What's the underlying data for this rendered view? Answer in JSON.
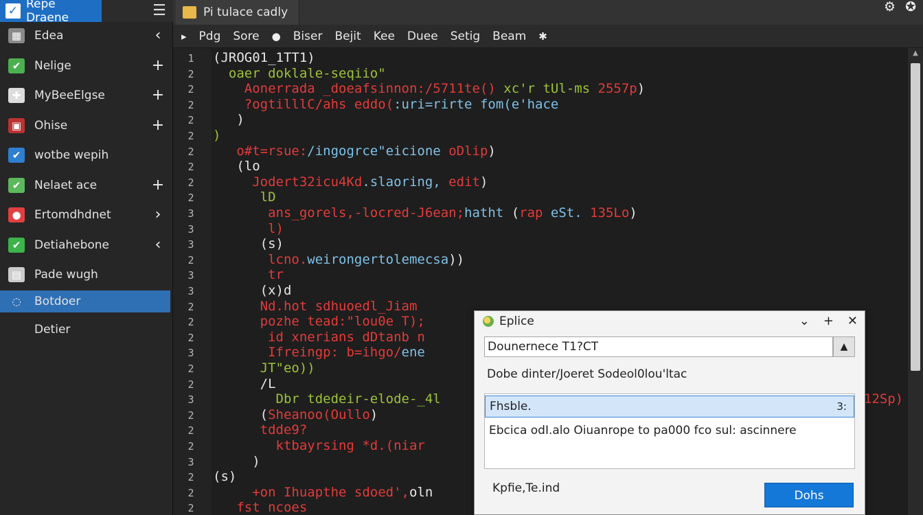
{
  "sidebar": {
    "title": "Repe Draene",
    "items": [
      {
        "label": "Edea",
        "action": "‹",
        "icon_color": "#8a8a8a"
      },
      {
        "label": "Nelige",
        "action": "+",
        "icon_color": "#4caf50"
      },
      {
        "label": "MyBeeElgse",
        "action": "+",
        "icon_color": "#dddddd"
      },
      {
        "label": "Ohise",
        "action": "+",
        "icon_color": "#b33"
      },
      {
        "label": "wotbe wepih",
        "action": "",
        "icon_color": "#2f7fd0"
      },
      {
        "label": "Nelaet ace",
        "action": "+",
        "icon_color": "#5cb85c"
      },
      {
        "label": "Ertomdhdnet",
        "action": "›",
        "icon_color": "#e04040"
      },
      {
        "label": "Detiahebone",
        "action": "‹",
        "icon_color": "#3cb44b"
      },
      {
        "label": "Pade wugh",
        "action": "",
        "icon_color": "#cccccc"
      },
      {
        "label": "Botdoer",
        "action": "",
        "icon_color": "#2f6fb4"
      },
      {
        "label": "Detier",
        "action": "",
        "icon_color": ""
      }
    ]
  },
  "tab": {
    "label": "Pi tulace cadly"
  },
  "menubar": {
    "items": [
      "Pdg",
      "Sore",
      "Biser",
      "Bejit",
      "Kee",
      "Duee",
      "Setig",
      "Beam"
    ]
  },
  "editor": {
    "line_numbers": [
      "1",
      "2",
      "2",
      "2",
      "2",
      "2",
      "2",
      "2",
      "2",
      "2",
      "3",
      "3",
      "3",
      "2",
      "3",
      "3",
      "2",
      "2",
      "2",
      "3",
      "2",
      "2",
      "3",
      "2",
      "2",
      "2",
      "3",
      "2",
      "2",
      "2"
    ],
    "lines": [
      {
        "parts": [
          {
            "t": "(JROG01_1TT1)",
            "c": "w"
          }
        ]
      },
      {
        "parts": [
          {
            "t": "  oaer doklale-seqiio\"",
            "c": "g"
          }
        ]
      },
      {
        "parts": [
          {
            "t": "    Aonerrada _doeafsinnon:/5711te() ",
            "c": "r"
          },
          {
            "t": "xc'r tUl-ms ",
            "c": "g"
          },
          {
            "t": "2557p",
            "c": "r"
          },
          {
            "t": ")",
            "c": "w"
          }
        ]
      },
      {
        "parts": [
          {
            "t": "    ?ogtilllC/ahs eddo(",
            "c": "r"
          },
          {
            "t": ":uri=rirte",
            "c": "b"
          },
          {
            "t": " fom(e'hace",
            "c": "b"
          }
        ]
      },
      {
        "parts": [
          {
            "t": "   )",
            "c": "w"
          }
        ]
      },
      {
        "parts": [
          {
            "t": ")",
            "c": "g"
          }
        ]
      },
      {
        "parts": [
          {
            "t": "   o#t=rsue:",
            "c": "r"
          },
          {
            "t": "/ingogrce\"eicione ",
            "c": "b"
          },
          {
            "t": "oDlip",
            "c": "r"
          },
          {
            "t": ")",
            "c": "w"
          }
        ]
      },
      {
        "parts": [
          {
            "t": "   (lo",
            "c": "w"
          }
        ]
      },
      {
        "parts": [
          {
            "t": "     Jodert32icu4Kd",
            "c": "r"
          },
          {
            "t": ".slaoring,",
            "c": "b"
          },
          {
            "t": " edit",
            "c": "r"
          },
          {
            "t": ")",
            "c": "w"
          }
        ]
      },
      {
        "parts": [
          {
            "t": "      lD",
            "c": "g"
          }
        ]
      },
      {
        "parts": [
          {
            "t": "       ans_gorels,-locred-J6ean;",
            "c": "r"
          },
          {
            "t": "hatht",
            "c": "b"
          },
          {
            "t": " (",
            "c": "w"
          },
          {
            "t": "rap",
            "c": "r"
          },
          {
            "t": " eSt.",
            "c": "b"
          },
          {
            "t": " 135Lo",
            "c": "r"
          },
          {
            "t": ")",
            "c": "w"
          }
        ]
      },
      {
        "parts": [
          {
            "t": "       l)",
            "c": "r"
          }
        ]
      },
      {
        "parts": [
          {
            "t": "      (s)",
            "c": "w"
          }
        ]
      },
      {
        "parts": [
          {
            "t": "       lcno.",
            "c": "r"
          },
          {
            "t": "weirongertolemecsa",
            "c": "b"
          },
          {
            "t": "))",
            "c": "w"
          }
        ]
      },
      {
        "parts": [
          {
            "t": "       tr",
            "c": "r"
          }
        ]
      },
      {
        "parts": [
          {
            "t": "      (x)d",
            "c": "w"
          }
        ]
      },
      {
        "parts": [
          {
            "t": "      Nd.hot sdhuoedl_Jiam",
            "c": "r"
          }
        ]
      },
      {
        "parts": [
          {
            "t": "      pozhe tead:\"lou0e T);",
            "c": "r"
          }
        ]
      },
      {
        "parts": [
          {
            "t": "       id xnerians dDtanb n",
            "c": "r"
          }
        ]
      },
      {
        "parts": [
          {
            "t": "       Ifreingp: ",
            "c": "r"
          },
          {
            "t": "b=ihgo/",
            "c": "r"
          },
          {
            "t": "ene",
            "c": "b"
          }
        ]
      },
      {
        "parts": [
          {
            "t": "      JT\"eo))",
            "c": "g"
          }
        ]
      },
      {
        "parts": [
          {
            "t": "      /L",
            "c": "w"
          }
        ]
      },
      {
        "parts": [
          {
            "t": "        Dbr tdedeir-elode-_4l",
            "c": "g"
          }
        ]
      },
      {
        "parts": [
          {
            "t": "      (",
            "c": "w"
          },
          {
            "t": "Sheanoo(Oullo",
            "c": "r"
          },
          {
            "t": ")",
            "c": "w"
          }
        ]
      },
      {
        "parts": [
          {
            "t": "      tdde9?",
            "c": "r"
          }
        ]
      },
      {
        "parts": [
          {
            "t": "        ktbayrsing *d.(niar",
            "c": "r"
          }
        ]
      },
      {
        "parts": [
          {
            "t": "     )",
            "c": "w"
          }
        ]
      },
      {
        "parts": [
          {
            "t": "(s)",
            "c": "w"
          }
        ]
      },
      {
        "parts": [
          {
            "t": "     +on Ihuapthe sdoed',",
            "c": "r"
          },
          {
            "t": "oln",
            "c": "w"
          }
        ]
      },
      {
        "parts": [
          {
            "t": "   fst ncoes ",
            "c": "r"
          }
        ]
      }
    ],
    "overflow_tail": "12Sp)"
  },
  "dialog": {
    "title": "Eplice",
    "controls": [
      "⌄",
      "+",
      "✕"
    ],
    "input_value": "Dounernece T1?CT",
    "label": "Dobe dinter/Joeret Sodeol0lou'ltac",
    "selected_item": "Fhsble.",
    "selected_shortcut": "3:",
    "description": "Ebcica odI.alo Oiuanrope to pa000 fco sul: ascinnere",
    "footer_text": "Kpfie,Te.ind",
    "button_label": "Dohs"
  }
}
